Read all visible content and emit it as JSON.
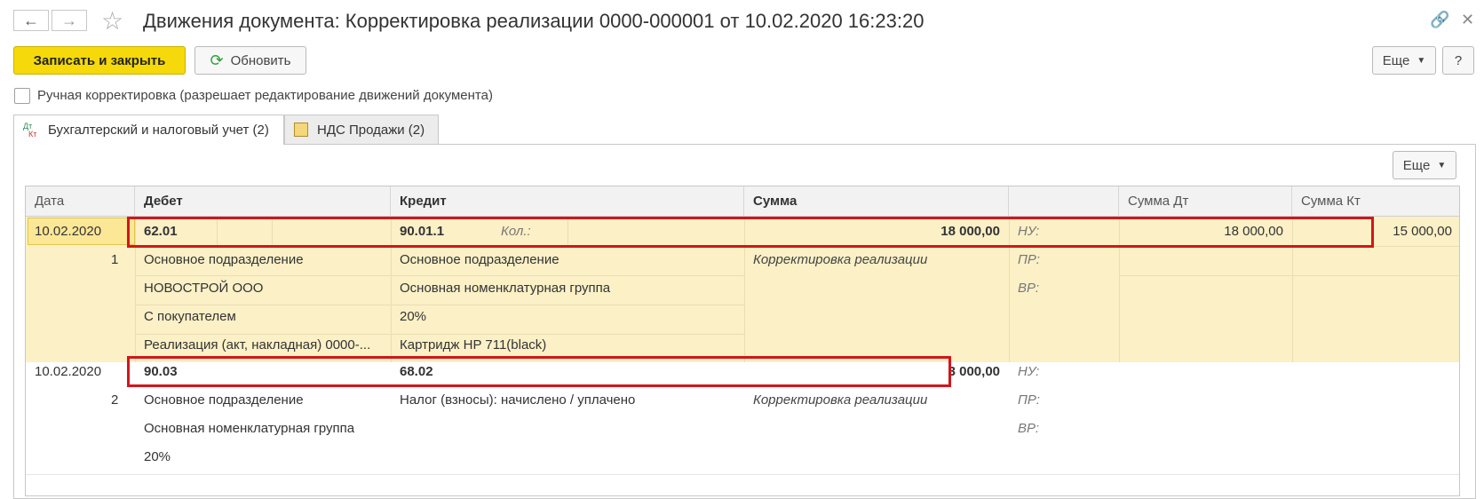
{
  "window": {
    "title": "Движения документа: Корректировка реализации 0000-000001 от 10.02.2020 16:23:20"
  },
  "toolbar": {
    "save_close": "Записать и закрыть",
    "refresh": "Обновить",
    "more": "Еще",
    "help": "?"
  },
  "manual_edit": {
    "label": "Ручная корректировка (разрешает редактирование движений документа)",
    "checked": false
  },
  "tabs": [
    {
      "label": "Бухгалтерский и налоговый учет (2)",
      "icon_text_top": "Дт",
      "icon_text_bottom": "Кт"
    },
    {
      "label": "НДС Продажи (2)"
    }
  ],
  "panel": {
    "more": "Еще"
  },
  "table": {
    "columns": [
      "Дата",
      "Дебет",
      "Кредит",
      "Сумма",
      "",
      "Сумма Дт",
      "Сумма Кт"
    ],
    "rows": [
      {
        "date": "10.02.2020",
        "num": "1",
        "debit_account": "62.01",
        "debit_sub": [
          "Основное подразделение",
          "НОВОСТРОЙ ООО",
          "С покупателем",
          "Реализация (акт, накладная) 0000-..."
        ],
        "credit_account": "90.01.1",
        "credit_qty_label": "Кол.:",
        "credit_sub": [
          "Основное подразделение",
          "Основная номенклатурная группа",
          "20%",
          "Картридж HP 711(black)"
        ],
        "amount": "18 000,00",
        "content": "Корректировка реализации",
        "nu": "НУ:",
        "pr": "ПР:",
        "vr": "ВР:",
        "sum_dt": "18 000,00",
        "sum_kt": "15 000,00"
      },
      {
        "date": "10.02.2020",
        "num": "2",
        "debit_account": "90.03",
        "debit_sub": [
          "Основное подразделение",
          "Основная номенклатурная группа",
          "20%"
        ],
        "credit_account": "68.02",
        "credit_sub": [
          "Налог (взносы): начислено / уплачено"
        ],
        "amount": "3 000,00",
        "content": "Корректировка реализации",
        "nu": "НУ:",
        "pr": "ПР:",
        "vr": "ВР:"
      }
    ]
  }
}
